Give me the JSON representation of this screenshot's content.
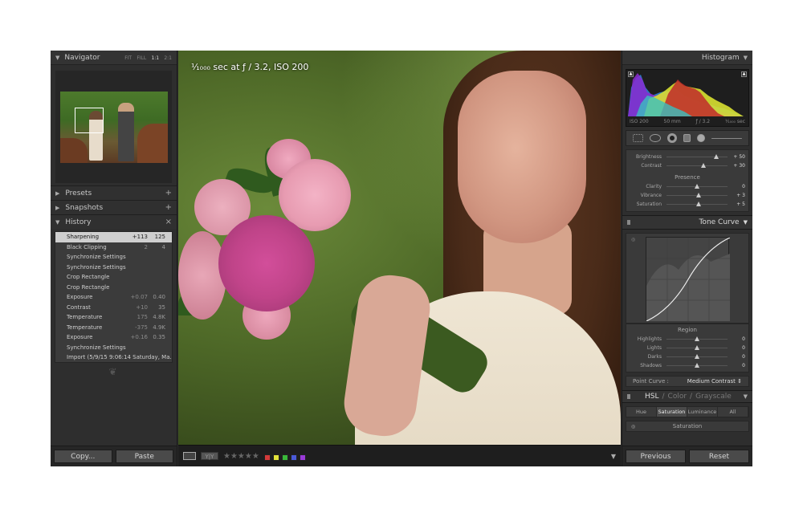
{
  "left": {
    "navigator": {
      "title": "Navigator",
      "zoom_links": [
        "FIT",
        "FILL",
        "1:1",
        "2:1"
      ]
    },
    "presets": {
      "title": "Presets"
    },
    "snapshots": {
      "title": "Snapshots"
    },
    "history": {
      "title": "History",
      "rows": [
        {
          "label": "Sharpening",
          "a": "+113",
          "b": "125",
          "selected": true
        },
        {
          "label": "Black Clipping",
          "a": "2",
          "b": "4"
        },
        {
          "label": "Synchronize Settings",
          "a": "",
          "b": ""
        },
        {
          "label": "Synchronize Settings",
          "a": "",
          "b": ""
        },
        {
          "label": "Crop Rectangle",
          "a": "",
          "b": ""
        },
        {
          "label": "Crop Rectangle",
          "a": "",
          "b": ""
        },
        {
          "label": "Exposure",
          "a": "+0.07",
          "b": "0.40"
        },
        {
          "label": "Contrast",
          "a": "+10",
          "b": "35"
        },
        {
          "label": "Temperature",
          "a": "175",
          "b": "4.8K"
        },
        {
          "label": "Temperature",
          "a": "-375",
          "b": "4.9K"
        },
        {
          "label": "Exposure",
          "a": "+0.16",
          "b": "0.35"
        },
        {
          "label": "Synchronize Settings",
          "a": "",
          "b": ""
        },
        {
          "label": "Import (5/9/15 9:06:14 Saturday, Ma...",
          "a": "",
          "b": ""
        }
      ]
    },
    "copy_label": "Copy...",
    "paste_label": "Paste"
  },
  "center": {
    "caption": "¹⁄₁₀₀₀ sec at ƒ / 3.2, ISO 200",
    "stars": "★★★★★",
    "swatches": [
      "#d33a3a",
      "#e2e23a",
      "#3ab83a",
      "#4a5ad8",
      "#9a3ad8"
    ]
  },
  "right": {
    "histogram": {
      "title": "Histogram",
      "info": [
        "ISO 200",
        "50 mm",
        "ƒ / 3.2",
        "¹⁄₁₀₀₀ sec"
      ]
    },
    "basic": {
      "sliders": [
        {
          "label": "Brightness",
          "value": "+ 50",
          "pos": 0.82
        },
        {
          "label": "Contrast",
          "value": "+ 30",
          "pos": 0.6
        }
      ],
      "presence_title": "Presence",
      "presence": [
        {
          "label": "Clarity",
          "value": "0",
          "pos": 0.5
        },
        {
          "label": "Vibrance",
          "value": "+ 3",
          "pos": 0.52
        },
        {
          "label": "Saturation",
          "value": "+ 5",
          "pos": 0.53
        }
      ]
    },
    "tone_curve": {
      "title": "Tone Curve",
      "region_title": "Region",
      "regions": [
        {
          "label": "Highlights",
          "value": "0",
          "pos": 0.5
        },
        {
          "label": "Lights",
          "value": "0",
          "pos": 0.5
        },
        {
          "label": "Darks",
          "value": "0",
          "pos": 0.5
        },
        {
          "label": "Shadows",
          "value": "0",
          "pos": 0.5
        }
      ],
      "point_curve_label": "Point Curve :",
      "point_curve_value": "Medium Contrast ⇕"
    },
    "hsl": {
      "title_hsl": "HSL",
      "title_color": "Color",
      "title_gray": "Grayscale",
      "sep": "/",
      "tabs": [
        "Hue",
        "Saturation",
        "Luminance",
        "All"
      ],
      "active_tab": "Saturation",
      "sub": "Saturation"
    },
    "previous_label": "Previous",
    "reset_label": "Reset"
  }
}
